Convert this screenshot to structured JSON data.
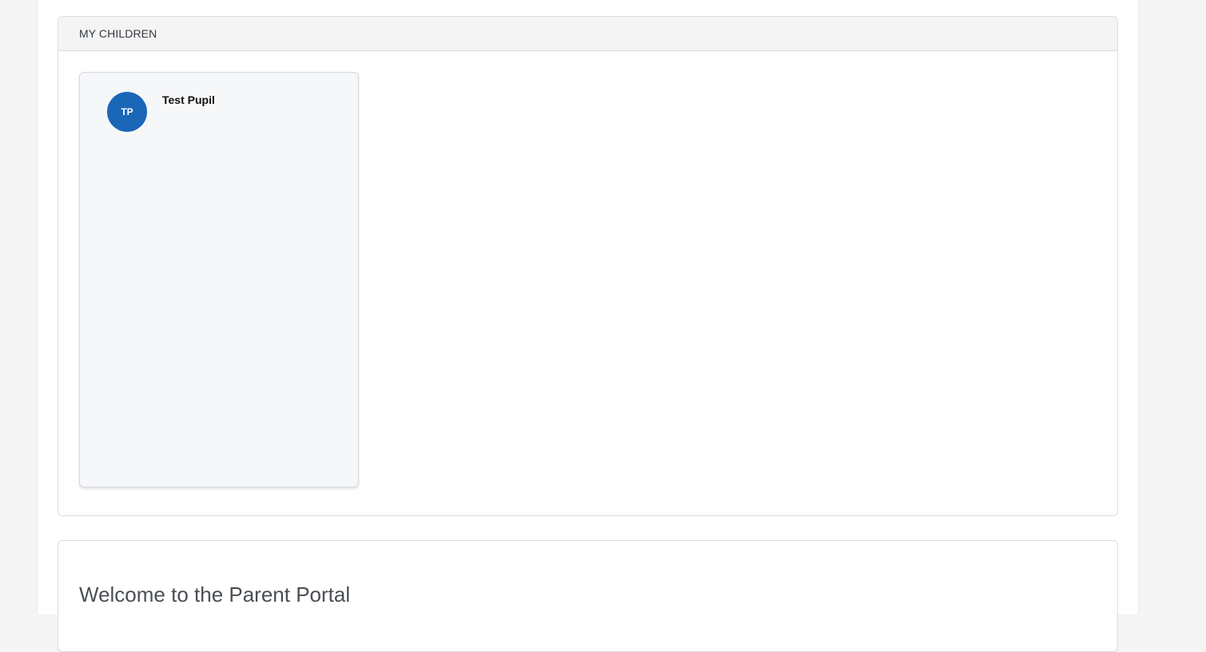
{
  "children_panel": {
    "title": "MY CHILDREN",
    "children": [
      {
        "initials": "TP",
        "name": "Test Pupil",
        "avatar_color": "#1a67b8"
      }
    ]
  },
  "welcome_panel": {
    "title": "Welcome to the Parent Portal"
  }
}
